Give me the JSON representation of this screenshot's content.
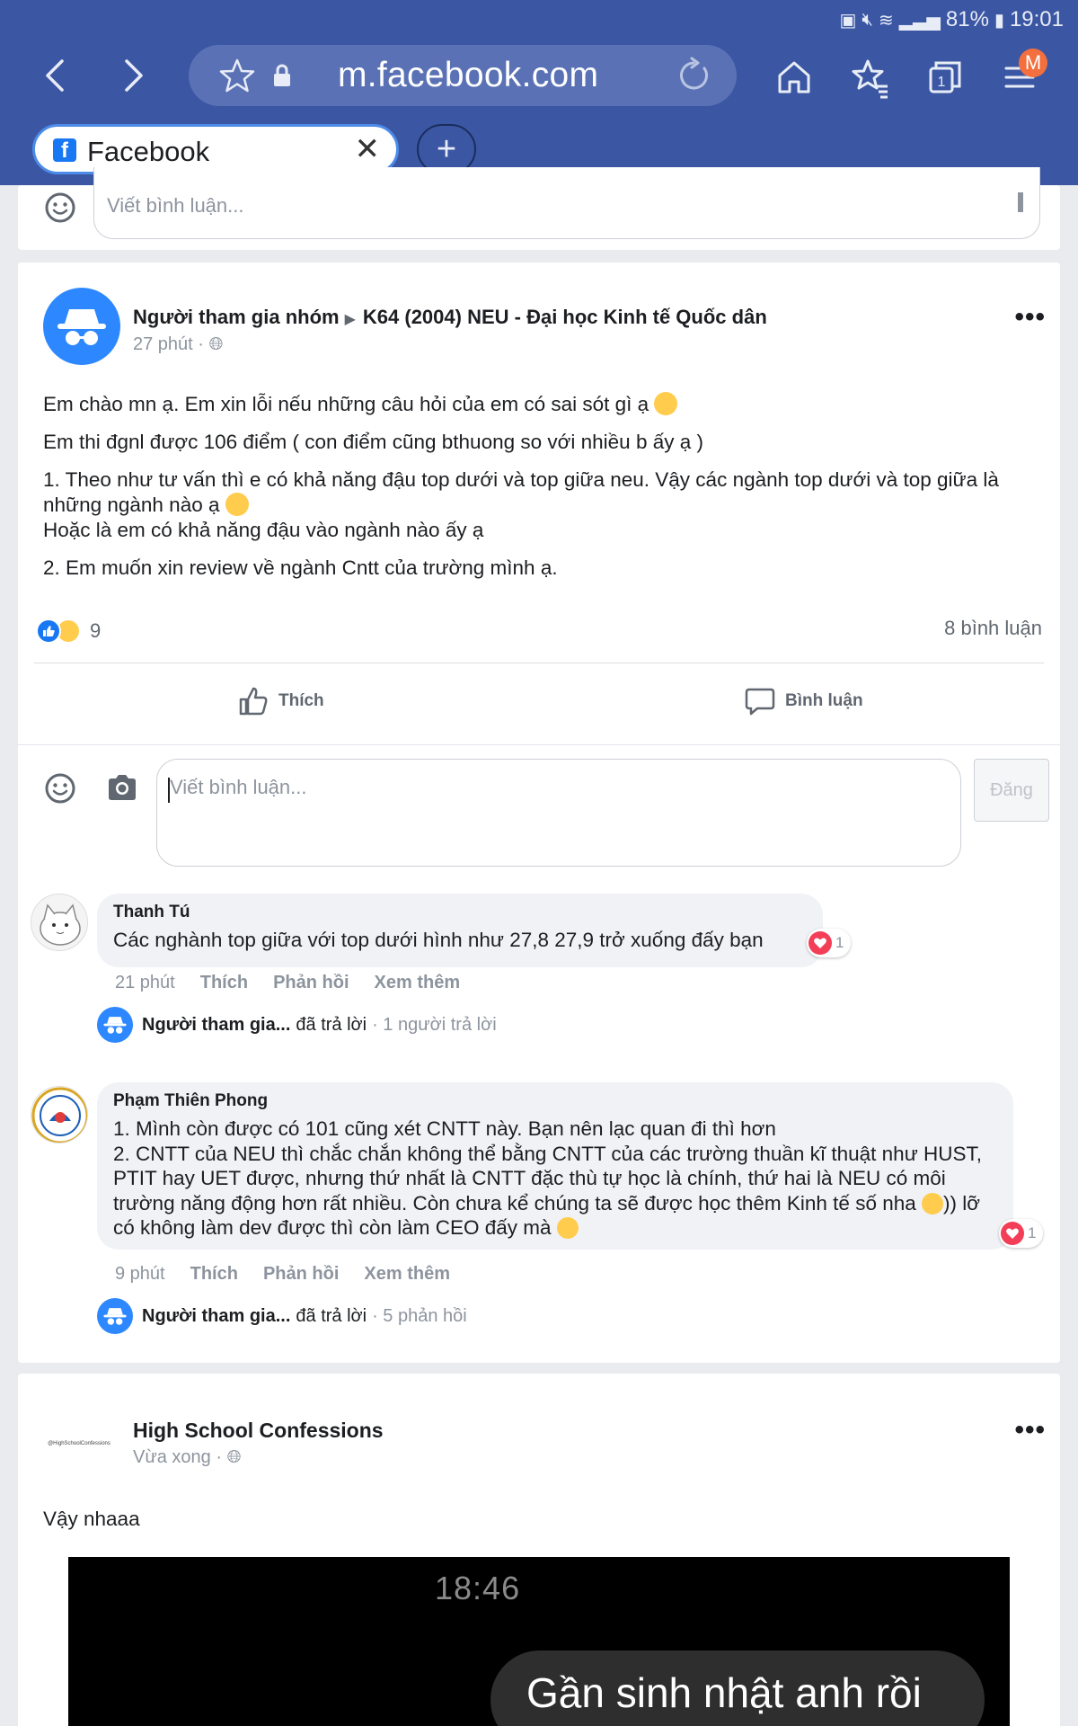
{
  "status": {
    "battery": "81%",
    "time": "19:01"
  },
  "browser": {
    "url": "m.facebook.com",
    "tab_title": "Facebook",
    "badge_letter": "M",
    "tab_count": "1",
    "accent_color": "#3b57a4"
  },
  "top_comment": {
    "placeholder": "Viết bình luận..."
  },
  "post1": {
    "author": "Người tham gia nhóm",
    "group": "K64 (2004) NEU - Đại học Kinh tế Quốc dân",
    "time": "27 phút",
    "lines": [
      "Em chào mn ạ. Em xin lỗi nếu những câu hỏi của em có sai sót gì ạ",
      "Em thi đgnl được 106 điểm ( con điểm cũng bthuong so với nhiều b ấy ạ )",
      "1. Theo như tư vấn thì e có khả năng đậu top dưới và top giữa neu. Vậy các ngành top dưới và top giữa là những ngành nào ạ",
      "Hoặc là em có khả năng đậu vào ngành nào ấy ạ",
      "2. Em muốn xin review về ngành Cntt của trường mình ạ."
    ],
    "reaction_count": "9",
    "comment_count": "8 bình luận",
    "like_label": "Thích",
    "comment_label": "Bình luận",
    "input_placeholder": "Viết bình luận...",
    "post_button": "Đăng",
    "comments": [
      {
        "name": "Thanh Tú",
        "text": "Các nghành top giữa với top dưới hình như 27,8 27,9 trở xuống đấy bạn",
        "heart_count": "1",
        "time": "21 phút",
        "like": "Thích",
        "reply": "Phản hồi",
        "more": "Xem thêm",
        "reply_summary": {
          "name": "Người tham gia...",
          "verb": "đã trả lời",
          "count": "· 1 người trả lời"
        }
      },
      {
        "name": "Phạm Thiên Phong",
        "line1": "1. Mình còn được có 101 cũng xét CNTT này. Bạn nên lạc quan đi thì hơn",
        "line2a": "2. CNTT của NEU thì chắc chắn không thể bằng CNTT của các trường thuần kĩ thuật như HUST, PTIT hay UET được, nhưng thứ nhất là CNTT đặc thù tự học là chính, thứ hai là NEU có môi trường năng động hơn rất nhiều. Còn chưa kể chúng ta sẽ được học thêm Kinh tế số nha",
        "line2b": ")) lỡ có không làm dev được thì còn làm CEO đấy mà",
        "heart_count": "1",
        "time": "9 phút",
        "like": "Thích",
        "reply": "Phản hồi",
        "more": "Xem thêm",
        "reply_summary": {
          "name": "Người tham gia...",
          "verb": "đã trả lời",
          "count": "· 5 phản hồi"
        }
      }
    ]
  },
  "post2": {
    "author": "High School Confessions",
    "logo_text": "@HighSchoolConfessions",
    "time": "Vừa xong",
    "text": "Vậy nhaaa",
    "video_time": "18:46",
    "video_message": "Gần sinh nhật anh rồi"
  },
  "colors": {
    "facebook_blue": "#1877f2",
    "heart_red": "#f33e58",
    "reaction_yellow": "#ffcc4d"
  }
}
